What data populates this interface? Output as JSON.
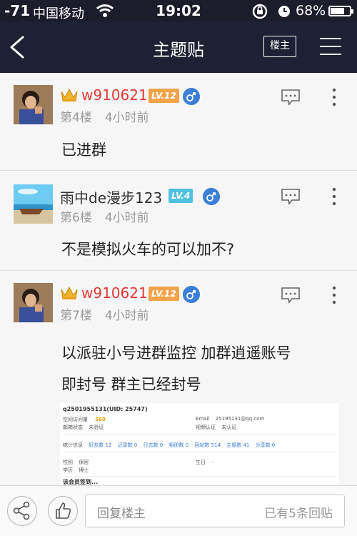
{
  "status": {
    "signal": "-71",
    "carrier": "中国移动",
    "time": "19:02",
    "battery": "68%"
  },
  "nav": {
    "title": "主题贴",
    "louzhu_label": "楼主"
  },
  "posts": [
    {
      "username": "w910621",
      "level": "LV.12",
      "floor": "第4楼",
      "time": "4小时前",
      "content": [
        "已进群"
      ]
    },
    {
      "username": "雨中de漫步123",
      "level": "LV.4",
      "floor": "第6楼",
      "time": "4小时前",
      "content": [
        "不是模拟火车的可以加不?"
      ]
    },
    {
      "username": "w910621",
      "level": "LV.12",
      "floor": "第7楼",
      "time": "4小时前",
      "content": [
        "以派驻小号进群监控 加群逍遥账号",
        "即封号 群主已经封号"
      ]
    }
  ],
  "screenshot": {
    "uid_line": "q2501955131(UID: 25747)",
    "points_label": "空间访问量",
    "points_value": "560",
    "email_label": "Email",
    "email_value": "25195131@qq.com",
    "mail_status_label": "邮箱状态",
    "mail_status_value": "未验证",
    "video_label": "视频认证",
    "video_value": "未认证",
    "stats_label": "统计信息",
    "stats": [
      "好友数 12",
      "记录数 0",
      "日志数 0",
      "相册数 0",
      "回帖数 514",
      "主题数 41",
      "分享数 0"
    ],
    "gender_label": "性别",
    "gender_value": "保密",
    "birthday_label": "生日",
    "birthday_value": "-",
    "edu_label": "学历",
    "edu_value": "博士",
    "footer": "该会员签到..."
  },
  "bottom": {
    "reply_placeholder": "回复楼主",
    "reply_count": "已有5条回贴"
  },
  "colors": {
    "nav_bg": "#1e2033",
    "vip_name": "#e53935",
    "level_orange": "#f3a34a",
    "level_blue": "#4fc0e0",
    "male_badge": "#3b7fd6"
  }
}
